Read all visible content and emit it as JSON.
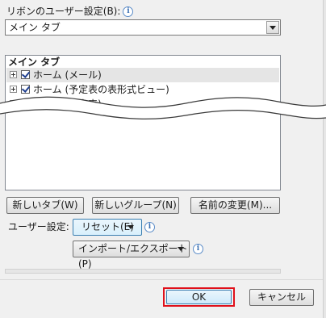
{
  "ribbon": {
    "label": "リボンのユーザー設定(B):",
    "dropdown_value": "メイン タブ"
  },
  "tree": {
    "header": "メイン タブ",
    "items": [
      {
        "label": "ホーム (メール)",
        "checked": true,
        "expanded": false
      },
      {
        "label": "ホーム (予定表の表形式ビュー)",
        "checked": true,
        "expanded": false
      },
      {
        "label": "ホーム (予定表)",
        "checked": true,
        "expanded": false
      }
    ]
  },
  "buttons": {
    "new_tab": "新しいタブ(W)",
    "new_group": "新しいグループ(N)",
    "rename": "名前の変更(M)..."
  },
  "user_settings": {
    "label": "ユーザー設定:",
    "reset": "リセット(E)",
    "import_export": "インポート/エクスポート(P)"
  },
  "footer": {
    "ok": "OK",
    "cancel": "キャンセル"
  },
  "colors": {
    "highlight": "#e0101a",
    "accent": "#3c7fb1"
  }
}
